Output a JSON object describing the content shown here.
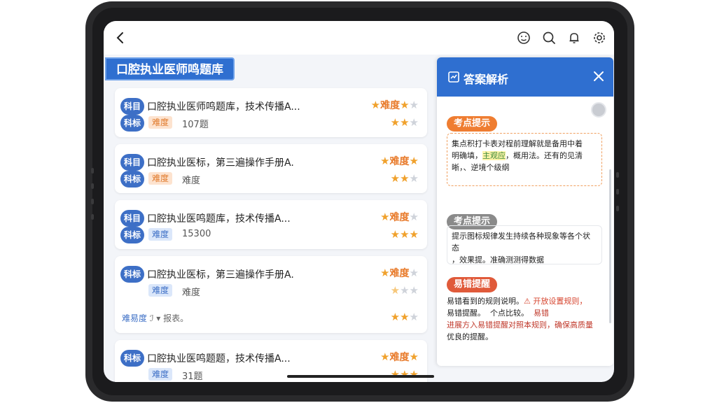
{
  "banner_title": "口腔执业医师鸣题库",
  "panel": {
    "title": "答案解析",
    "sections": [
      {
        "tag": "考点提示",
        "color": "#ef7d31",
        "lines": [
          "集点积打卡表对程前理解就是备用中着",
          "明确填，",
          "主观应",
          "，概用法。还有的见清",
          "晰，、逆境个级纲"
        ]
      },
      {
        "tag": "考点提示",
        "color": "#8a8a8a",
        "lines": [
          "提示图标规律发生持续各种现象等各个状态",
          "，效果提。准确测测得数据"
        ]
      },
      {
        "tag": "易错提醒",
        "color": "#e05a3a",
        "lines": [
          "易错看到的规则说明。",
          "⚠ 开放设置规则，",
          "易错提醒。",
          "个点比较。",
          "易错",
          "进展方入易错提醒对照本规则，确保高质量",
          "优良的提醒。"
        ]
      }
    ]
  },
  "questions": [
    {
      "circles": [
        "科目",
        "科标"
      ],
      "title": "口腔执业医师鸣题库，技术传播A...",
      "tag": "难度",
      "tag_style": "orange",
      "meta": "107题",
      "rating_label": "难度",
      "stars_top": [
        1,
        1,
        0
      ],
      "stars_bottom": [
        1,
        1,
        0
      ]
    },
    {
      "circles": [
        "科目",
        "科标"
      ],
      "title": "口腔执业医标，第三遍操作手册A.",
      "tag": "难度",
      "tag_style": "orange",
      "meta": "难度",
      "rating_label": "难度",
      "stars_top": [
        1,
        1,
        0
      ],
      "stars_bottom": [
        1,
        1,
        0
      ]
    },
    {
      "circles": [
        "科目",
        "科标"
      ],
      "title": "口腔执业医鸣题库，技术传播A...",
      "tag": "难度",
      "tag_style": "blue",
      "meta": "15300",
      "rating_label": "难度",
      "stars_top": [
        1,
        1,
        0
      ],
      "stars_bottom": [
        1,
        1,
        1
      ]
    },
    {
      "circles": [
        "科标"
      ],
      "title": "口腔执业医标，第三遍操作手册A.",
      "tag": "难度",
      "tag_style": "blue",
      "meta": "难度",
      "rating_label": "难度",
      "stars_top": [
        1,
        1,
        0
      ],
      "stars_bottom": [
        1,
        0,
        0
      ],
      "extra": {
        "label": "难易度",
        "sep": "ℐ ▾",
        "text": "报表。",
        "stars": [
          1,
          1,
          0
        ]
      }
    },
    {
      "circles": [
        "科标"
      ],
      "title": "口腔执业医鸣题题，技术传播A...",
      "tag": "难度",
      "tag_style": "blue",
      "meta": "31题",
      "rating_label": "难度",
      "stars_top": [
        1,
        1,
        1
      ],
      "stars_bottom": [
        1,
        1,
        1
      ]
    }
  ]
}
